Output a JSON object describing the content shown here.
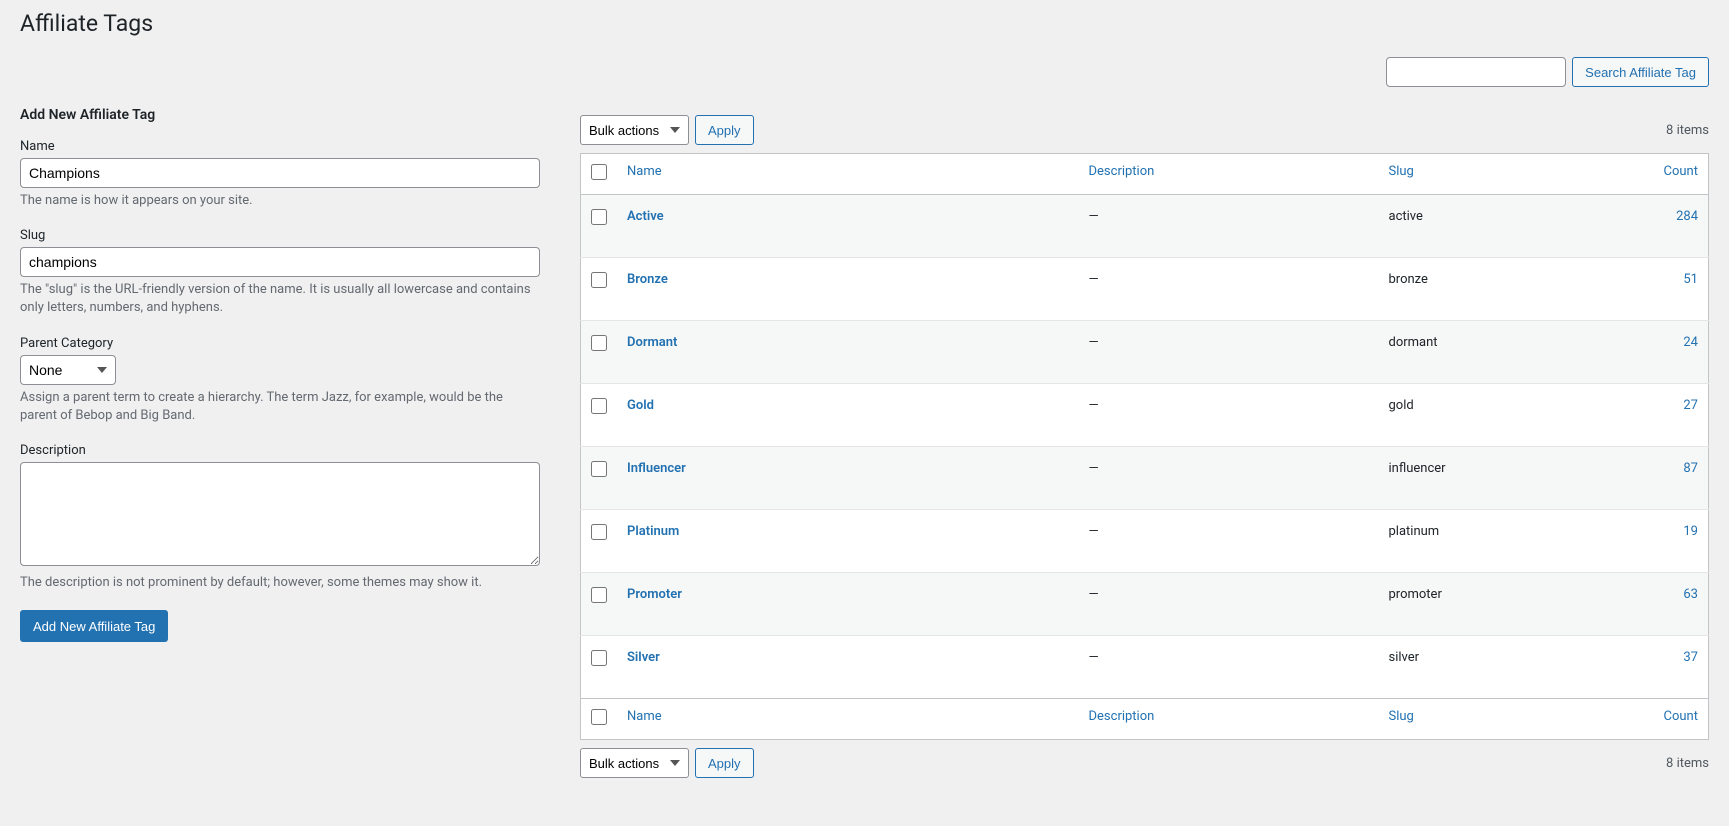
{
  "page": {
    "title": "Affiliate Tags"
  },
  "search": {
    "value": "",
    "button": "Search Affiliate Tag"
  },
  "form": {
    "heading": "Add New Affiliate Tag",
    "name": {
      "label": "Name",
      "value": "Champions",
      "help": "The name is how it appears on your site."
    },
    "slug": {
      "label": "Slug",
      "value": "champions",
      "help": "The \"slug\" is the URL-friendly version of the name. It is usually all lowercase and contains only letters, numbers, and hyphens."
    },
    "parent": {
      "label": "Parent Category",
      "value": "None",
      "help": "Assign a parent term to create a hierarchy. The term Jazz, for example, would be the parent of Bebop and Big Band."
    },
    "description": {
      "label": "Description",
      "value": "",
      "help": "The description is not prominent by default; however, some themes may show it."
    },
    "submit": "Add New Affiliate Tag"
  },
  "bulk": {
    "label": "Bulk actions",
    "apply": "Apply"
  },
  "list": {
    "count_label": "8 items",
    "columns": {
      "name": "Name",
      "description": "Description",
      "slug": "Slug",
      "count": "Count"
    },
    "rows": [
      {
        "name": "Active",
        "description": "—",
        "slug": "active",
        "count": "284"
      },
      {
        "name": "Bronze",
        "description": "—",
        "slug": "bronze",
        "count": "51"
      },
      {
        "name": "Dormant",
        "description": "—",
        "slug": "dormant",
        "count": "24"
      },
      {
        "name": "Gold",
        "description": "—",
        "slug": "gold",
        "count": "27"
      },
      {
        "name": "Influencer",
        "description": "—",
        "slug": "influencer",
        "count": "87"
      },
      {
        "name": "Platinum",
        "description": "—",
        "slug": "platinum",
        "count": "19"
      },
      {
        "name": "Promoter",
        "description": "—",
        "slug": "promoter",
        "count": "63"
      },
      {
        "name": "Silver",
        "description": "—",
        "slug": "silver",
        "count": "37"
      }
    ]
  }
}
